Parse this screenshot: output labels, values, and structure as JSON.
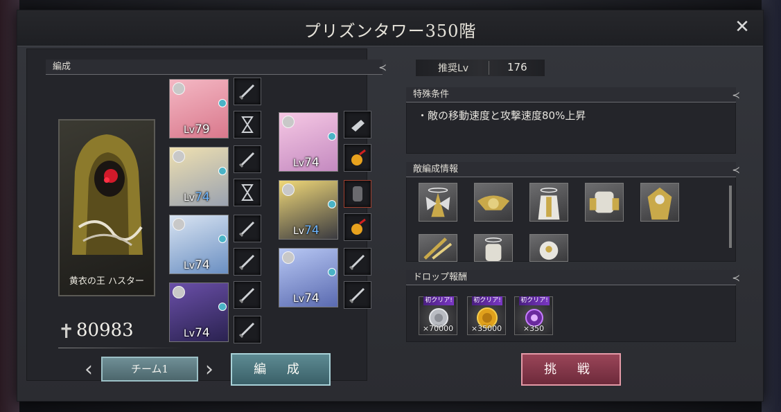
{
  "title": "プリズンタワー350階",
  "formation": {
    "header": "編成",
    "leader_name": "黄衣の王 ハスター",
    "power": "80983",
    "characters": [
      {
        "level_prefix": "Lv",
        "level": "79",
        "tint": "pink"
      },
      {
        "level_prefix": "Lv",
        "level": "74",
        "tint": "blonde"
      },
      {
        "level_prefix": "Lv",
        "level": "74",
        "tint": "silver"
      },
      {
        "level_prefix": "Lv",
        "level": "74",
        "tint": "purple"
      },
      {
        "level_prefix": "Lv",
        "level": "74",
        "tint": "rose"
      },
      {
        "level_prefix": "Lv",
        "level": "74",
        "tint": "gold"
      },
      {
        "level_prefix": "Lv",
        "level": "74",
        "tint": "blue"
      }
    ],
    "team_label": "チーム1",
    "edit_button": "編 成"
  },
  "recommended": {
    "label": "推奨Lv",
    "value": "176"
  },
  "special_conditions": {
    "header": "特殊条件",
    "text": "・敵の移動速度と攻撃速度80%上昇"
  },
  "enemy_info": {
    "header": "敵編成情報",
    "count": 8
  },
  "drop_rewards": {
    "header": "ドロップ報酬",
    "items": [
      {
        "tag": "初クリア!",
        "amount": "×70000",
        "icon": "silver-medal-icon"
      },
      {
        "tag": "初クリア!",
        "amount": "×35000",
        "icon": "gold-coin-icon"
      },
      {
        "tag": "初クリア!",
        "amount": "×350",
        "icon": "purple-gem-icon"
      }
    ]
  },
  "challenge_button": "挑 戦",
  "colors": {
    "accent_teal": "#5d8b93",
    "accent_red": "#9a4558",
    "level_blue": "#6fb7ff"
  }
}
